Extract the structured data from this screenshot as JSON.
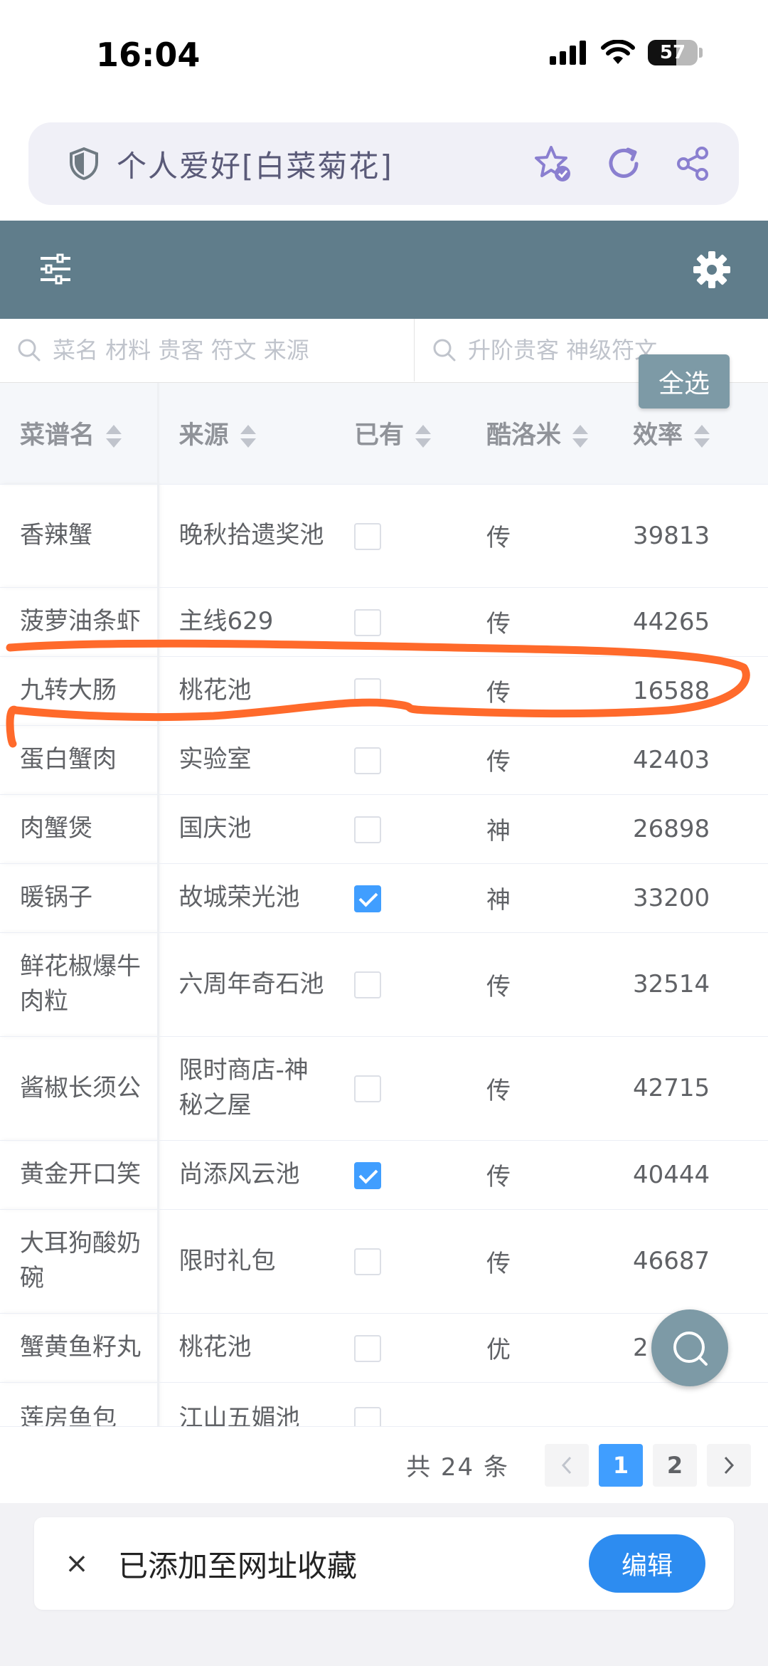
{
  "status_bar": {
    "time": "16:04",
    "battery": "57",
    "battery_level": 0.57
  },
  "browser": {
    "title": "个人爱好[白菜菊花]"
  },
  "search": {
    "placeholder_1": "菜名 材料 贵客 符文 来源",
    "placeholder_2": "升阶贵客 神级符文"
  },
  "select_all_label": "全选",
  "table": {
    "headers": [
      "菜谱名",
      "来源",
      "已有",
      "酷洛米",
      "效率"
    ],
    "rows": [
      {
        "name": "香辣蟹",
        "source": "晚秋拾遗奖池",
        "owned": false,
        "kuromi": "传",
        "efficiency": "39813"
      },
      {
        "name": "菠萝油条虾",
        "source": "主线629",
        "owned": false,
        "kuromi": "传",
        "efficiency": "44265"
      },
      {
        "name": "九转大肠",
        "source": "桃花池",
        "owned": false,
        "kuromi": "传",
        "efficiency": "16588"
      },
      {
        "name": "蛋白蟹肉",
        "source": "实验室",
        "owned": false,
        "kuromi": "传",
        "efficiency": "42403"
      },
      {
        "name": "肉蟹煲",
        "source": "国庆池",
        "owned": false,
        "kuromi": "神",
        "efficiency": "26898"
      },
      {
        "name": "暖锅子",
        "source": "故城荣光池",
        "owned": true,
        "kuromi": "神",
        "efficiency": "33200"
      },
      {
        "name": "鲜花椒爆牛肉粒",
        "source": "六周年奇石池",
        "owned": false,
        "kuromi": "传",
        "efficiency": "32514"
      },
      {
        "name": "酱椒长须公",
        "source": "限时商店-神秘之屋",
        "owned": false,
        "kuromi": "传",
        "efficiency": "42715"
      },
      {
        "name": "黄金开口笑",
        "source": "尚添风云池",
        "owned": true,
        "kuromi": "传",
        "efficiency": "40444"
      },
      {
        "name": "大耳狗酸奶碗",
        "source": "限时礼包",
        "owned": false,
        "kuromi": "传",
        "efficiency": "46687"
      },
      {
        "name": "蟹黄鱼籽丸",
        "source": "桃花池",
        "owned": false,
        "kuromi": "优",
        "efficiency": "2"
      },
      {
        "name": "莲房鱼包",
        "source": "江山五媚池",
        "owned": false,
        "kuromi": "",
        "efficiency": ""
      }
    ]
  },
  "pagination": {
    "total": "共 24 条",
    "pages": [
      "1",
      "2"
    ],
    "current": "1"
  },
  "toast": {
    "message": "已添加至网址收藏",
    "edit_label": "编辑",
    "close": "×"
  },
  "colors": {
    "toolbar": "#607d8b",
    "accent": "#409eff",
    "annotation": "#ff6a2b"
  }
}
